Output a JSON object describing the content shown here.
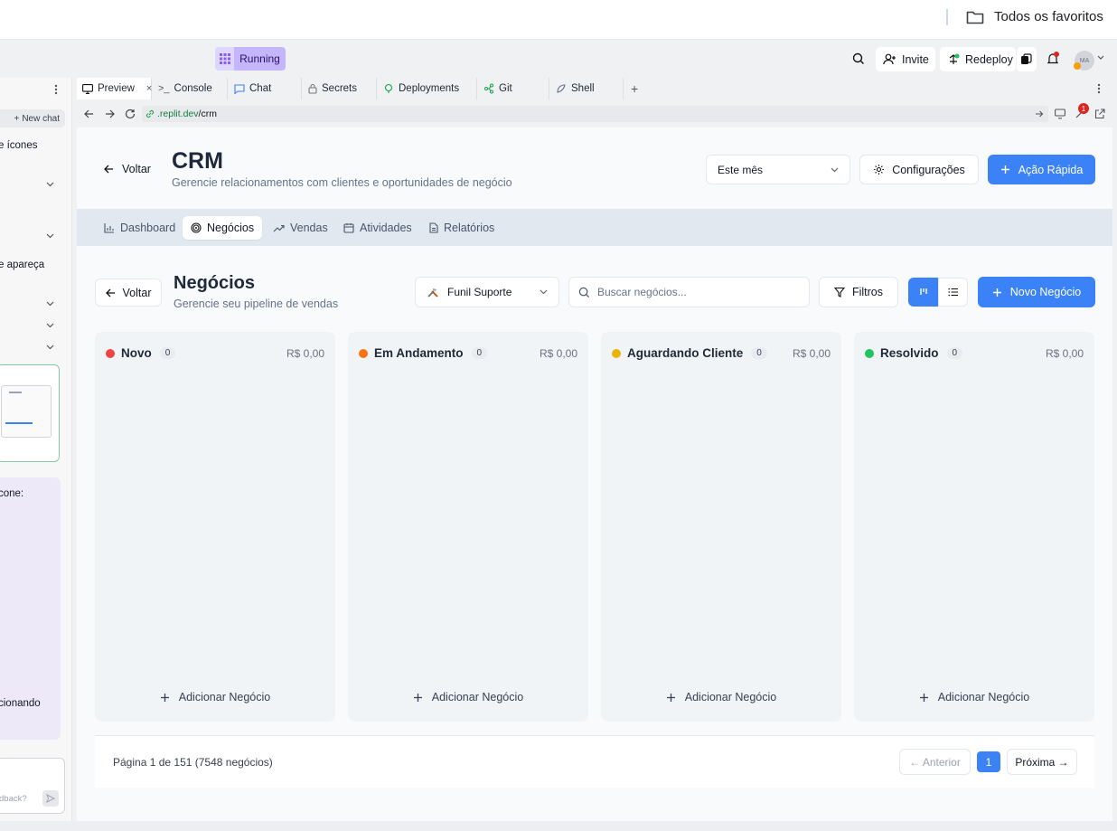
{
  "browser": {
    "bookmarks_folder": "Todos os favoritos"
  },
  "replit": {
    "status": "Running",
    "invite_label": "Invite",
    "redeploy_label": "Redeploy",
    "avatar_initials": "MA",
    "notification_count": "1",
    "tabs": [
      {
        "label": "Preview"
      },
      {
        "label": "Console"
      },
      {
        "label": "Chat"
      },
      {
        "label": "Secrets"
      },
      {
        "label": "Deployments"
      },
      {
        "label": "Git"
      },
      {
        "label": "Shell"
      }
    ],
    "url_domain": ".replit.dev",
    "url_path": "/crm"
  },
  "left_panel": {
    "new_chat_label": "New chat",
    "snippets": [
      "e ícones",
      "e apareça",
      "cone:",
      "cionando",
      "dback?"
    ]
  },
  "crm": {
    "back_label": "Voltar",
    "title": "CRM",
    "subtitle": "Gerencie relacionamentos com clientes e oportunidades de negócio",
    "period_select": "Este mês",
    "settings_label": "Configurações",
    "quick_action_label": "Ação Rápida",
    "nav": [
      {
        "label": "Dashboard"
      },
      {
        "label": "Negócios"
      },
      {
        "label": "Vendas"
      },
      {
        "label": "Atividades"
      },
      {
        "label": "Relatórios"
      }
    ]
  },
  "deals": {
    "back_label": "Voltar",
    "title": "Negócios",
    "subtitle": "Gerencie seu pipeline de vendas",
    "pipeline_select": "Funil Suporte",
    "search_placeholder": "Buscar negócios...",
    "filters_label": "Filtros",
    "new_deal_label": "Novo Negócio",
    "add_deal_label": "Adicionar Negócio",
    "columns": [
      {
        "name": "Novo",
        "count": "0",
        "total": "R$ 0,00",
        "color": "#ef4444"
      },
      {
        "name": "Em Andamento",
        "count": "0",
        "total": "R$ 0,00",
        "color": "#f97316"
      },
      {
        "name": "Aguardando Cliente",
        "count": "0",
        "total": "R$ 0,00",
        "color": "#eab308"
      },
      {
        "name": "Resolvido",
        "count": "0",
        "total": "R$ 0,00",
        "color": "#22c55e"
      }
    ],
    "pagination": {
      "info": "Página 1 de 151 (7548 negócios)",
      "prev_label": "← Anterior",
      "current_page": "1",
      "next_label": "Próxima →"
    }
  }
}
